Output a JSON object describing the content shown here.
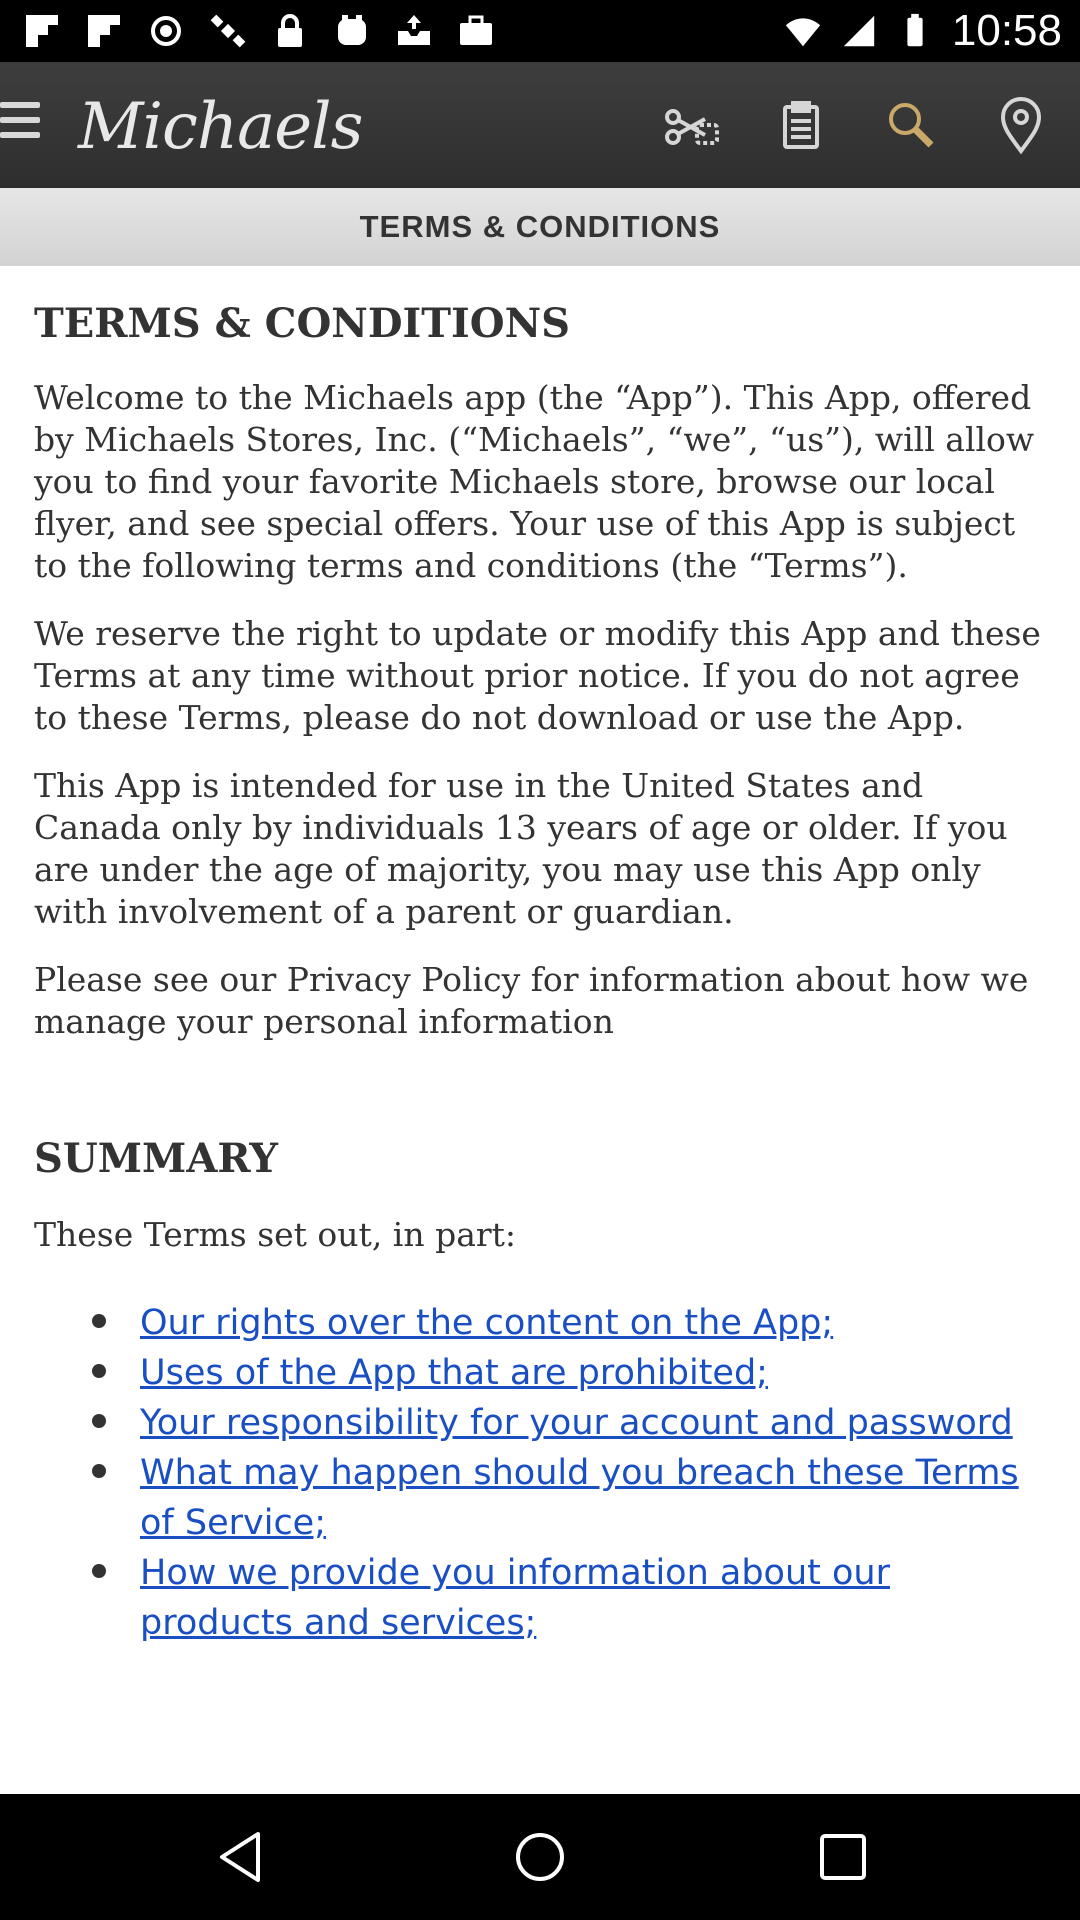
{
  "status_bar": {
    "time": "10:58",
    "left_icons": [
      "flipboard-icon",
      "flipboard-icon",
      "gps-icon",
      "satellite-icon",
      "lock-icon",
      "gamepad-icon",
      "inbox-upload-icon",
      "briefcase-icon"
    ],
    "right_icons": [
      "wifi-icon",
      "signal-icon",
      "battery-icon"
    ]
  },
  "app_bar": {
    "brand": "Michaels",
    "icons": [
      "menu-icon",
      "coupon-scissors-icon",
      "shopping-list-icon",
      "search-icon",
      "location-pin-icon"
    ],
    "background": "#353535"
  },
  "section_header": {
    "title": "TERMS & CONDITIONS"
  },
  "content": {
    "heading": "TERMS & CONDITIONS",
    "paragraphs": [
      "Welcome to the Michaels app (the “App”). This App, offered by Michaels Stores, Inc. (“Michaels”, “we”, “us”), will allow you to find your favorite Michaels store, browse our local flyer, and see special offers. Your use of this App is subject to the following terms and conditions (the “Terms”).",
      "We reserve the right to update or modify this App and these Terms at any time without prior notice. If you do not agree to these Terms, please do not download or use the App.",
      "This App is intended for use in the United States and Canada only by individuals 13 years of age or older. If you are under the age of majority, you may use this App only with involvement of a parent or guardian.",
      "Please see our Privacy Policy for information about how we manage your personal information"
    ],
    "summary_heading": "SUMMARY",
    "summary_intro": "These Terms set out, in part:",
    "summary_links": [
      "Our rights over the content on the App;",
      "Uses of the App that are prohibited;",
      "Your responsibility for your account and password",
      "What may happen should you breach these Terms of Service;",
      "How we provide you information about our products and services;"
    ],
    "link_color": "#1a4fc4"
  },
  "nav_bar": {
    "icons": [
      "back-icon",
      "home-icon",
      "recents-icon"
    ]
  }
}
